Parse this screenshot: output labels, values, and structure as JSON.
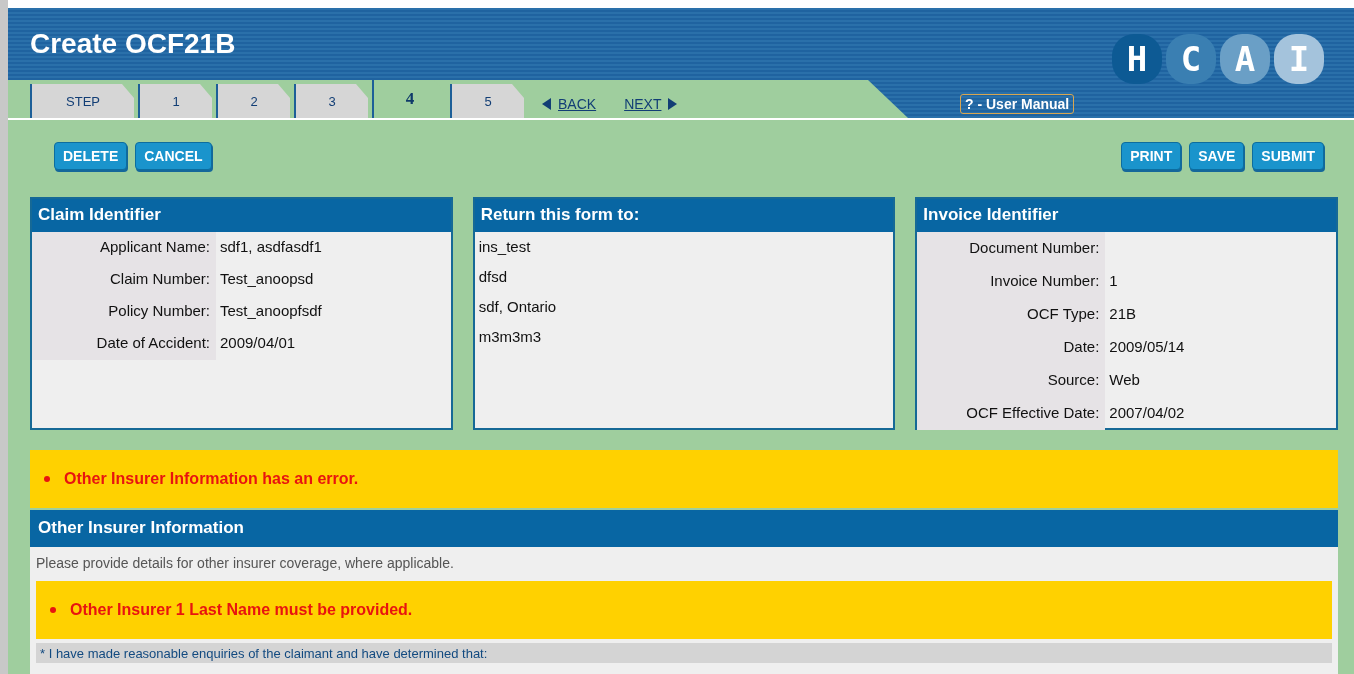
{
  "header": {
    "title": "Create OCF21B",
    "logo_letters": [
      "H",
      "C",
      "A",
      "I"
    ],
    "user_manual": "? - User Manual"
  },
  "tabs": [
    {
      "label": "STEP",
      "selected": false
    },
    {
      "label": "1",
      "selected": false
    },
    {
      "label": "2",
      "selected": false
    },
    {
      "label": "3",
      "selected": false
    },
    {
      "label": "4",
      "selected": true
    },
    {
      "label": "5",
      "selected": false
    }
  ],
  "nav": {
    "back": "BACK",
    "next": "NEXT"
  },
  "left_buttons": [
    "DELETE",
    "CANCEL"
  ],
  "right_buttons": [
    "PRINT",
    "SAVE",
    "SUBMIT"
  ],
  "claim_identifier": {
    "title": "Claim Identifier",
    "fields": [
      {
        "label": "Applicant Name:",
        "value": "sdf1, asdfasdf1"
      },
      {
        "label": "Claim Number:",
        "value": "Test_anoopsd"
      },
      {
        "label": "Policy Number:",
        "value": "Test_anoopfsdf"
      },
      {
        "label": "Date of Accident:",
        "value": "2009/04/01"
      }
    ]
  },
  "return_to": {
    "title": "Return this form to:",
    "lines": [
      "ins_test",
      "dfsd",
      "sdf, Ontario",
      "m3m3m3"
    ]
  },
  "invoice_identifier": {
    "title": "Invoice Identifier",
    "fields": [
      {
        "label": "Document Number:"
      },
      {
        "label": "Invoice Number:",
        "value": "1"
      },
      {
        "label": "OCF Type:",
        "value": "21B"
      },
      {
        "label": "Date:",
        "value": "2009/05/14"
      },
      {
        "label": "Source:",
        "value": "Web"
      },
      {
        "label": "OCF Effective Date:",
        "value": "2007/04/02"
      }
    ]
  },
  "section_error": "Other Insurer Information has an error.",
  "other_insurer": {
    "title": "Other Insurer Information",
    "intro": "Please provide details for other insurer coverage, where applicable.",
    "error": "Other Insurer 1 Last Name must be provided.",
    "statement": "* I have made reasonable enquiries of the claimant and have determined that:"
  }
}
